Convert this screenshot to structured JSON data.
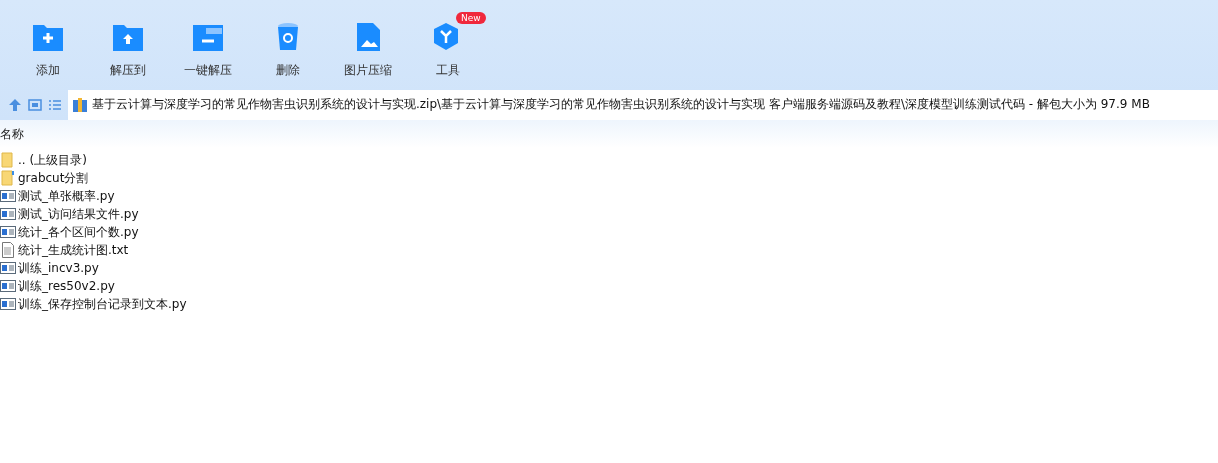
{
  "toolbar": [
    {
      "kind": "add",
      "label": "添加"
    },
    {
      "kind": "extract",
      "label": "解压到"
    },
    {
      "kind": "oneclick",
      "label": "一键解压"
    },
    {
      "kind": "delete",
      "label": "删除"
    },
    {
      "kind": "image",
      "label": "图片压缩"
    },
    {
      "kind": "tools",
      "label": "工具",
      "badge": "New"
    }
  ],
  "address": "基于云计算与深度学习的常见作物害虫识别系统的设计与实现.zip\\基于云计算与深度学习的常见作物害虫识别系统的设计与实现 客户端服务端源码及教程\\深度模型训练测试代码 - 解包大小为 97.9 MB",
  "columns": [
    "名称"
  ],
  "files": [
    {
      "kind": "parent",
      "name": ".. (上级目录)"
    },
    {
      "kind": "folder",
      "name": "grabcut分割"
    },
    {
      "kind": "py",
      "name": "测试_单张概率.py"
    },
    {
      "kind": "py",
      "name": "测试_访问结果文件.py"
    },
    {
      "kind": "py",
      "name": "统计_各个区间个数.py"
    },
    {
      "kind": "txt",
      "name": "统计_生成统计图.txt"
    },
    {
      "kind": "py",
      "name": "训练_incv3.py"
    },
    {
      "kind": "py",
      "name": "训练_res50v2.py"
    },
    {
      "kind": "py",
      "name": "训练_保存控制台记录到文本.py"
    }
  ]
}
